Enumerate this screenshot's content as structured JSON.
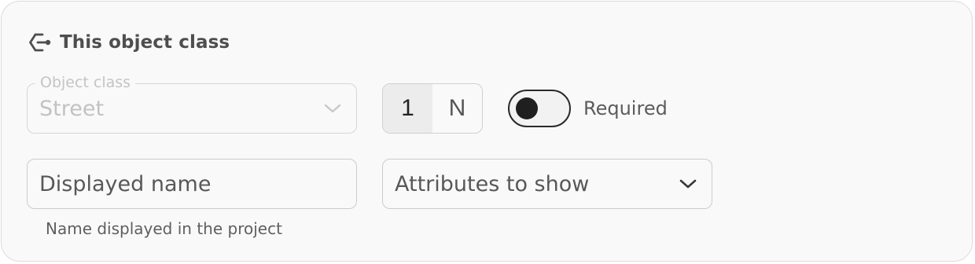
{
  "section": {
    "icon": "object-class-icon",
    "title": "This object class"
  },
  "object_class": {
    "label": "Object class",
    "value": "Street",
    "disabled": true,
    "icon": "chevron-down-icon"
  },
  "cardinality": {
    "options": [
      "1",
      "N"
    ],
    "selected": "1"
  },
  "required_toggle": {
    "label": "Required",
    "checked": false
  },
  "displayed_name": {
    "placeholder": "Displayed name",
    "value": "",
    "helper": "Name displayed in the project"
  },
  "attributes": {
    "placeholder": "Attributes to show",
    "icon": "chevron-down-icon"
  },
  "colors": {
    "border": "#cccccc",
    "card_background": "#f9f9f9",
    "toggle_knob": "#1f1f1f",
    "disabled_text": "#c2c2c2"
  }
}
